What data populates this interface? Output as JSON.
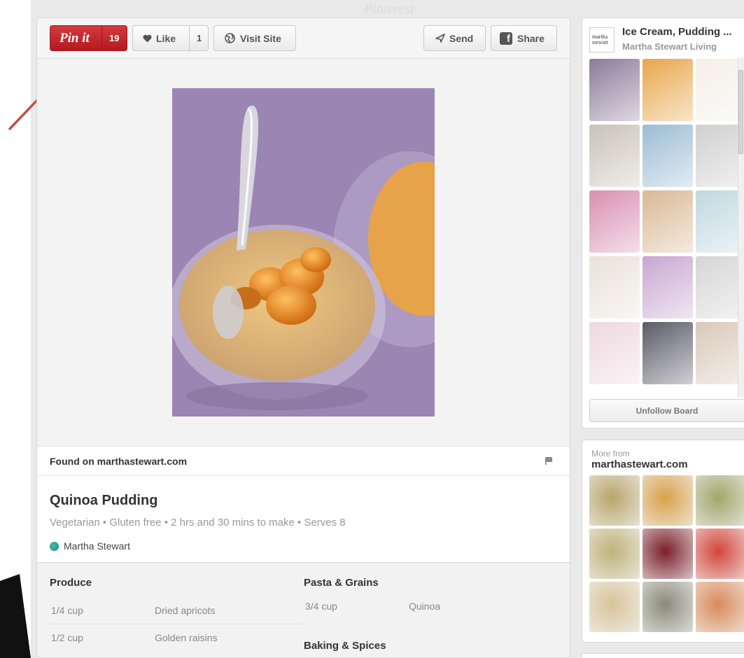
{
  "toolbar": {
    "pinit_label": "Pin it",
    "pinit_count": "19",
    "like_label": "Like",
    "like_count": "1",
    "visit_label": "Visit Site",
    "send_label": "Send",
    "share_label": "Share"
  },
  "found": {
    "text": "Found on marthastewart.com"
  },
  "recipe": {
    "title": "Quinoa Pudding",
    "meta": "Vegetarian • Gluten free • 2 hrs and 30 mins to make • Serves 8",
    "author": "Martha Stewart"
  },
  "ingredients": {
    "groups": [
      {
        "heading": "Produce",
        "rows": [
          {
            "qty": "1/4 cup",
            "item": "Dried apricots"
          },
          {
            "qty": "1/2 cup",
            "item": "Golden raisins"
          }
        ]
      },
      {
        "heading": "Pasta & Grains",
        "rows": [
          {
            "qty": "3/4 cup",
            "item": "Quinoa"
          }
        ]
      },
      {
        "heading": "Baking & Spices",
        "rows": []
      }
    ]
  },
  "board": {
    "logo_line1": "martha",
    "logo_line2": "stewart",
    "title": "Ice Cream, Pudding ...",
    "subtitle": "Martha Stewart Living",
    "unfollow_label": "Unfollow Board",
    "thumb_colors": [
      "#8c7a99",
      "#e8a64a",
      "#f4efe8",
      "#c9c2b6",
      "#9bbcd3",
      "#cfcfcf",
      "#d88fb0",
      "#d9b894",
      "#bfd8e0",
      "#e9e2d8",
      "#c8a7d1",
      "#d5d5d5",
      "#eed8e0",
      "#5a5a66",
      "#d9c8b8"
    ]
  },
  "more": {
    "label": "More from",
    "site": "marthastewart.com",
    "thumb_colors": [
      "#b9a56a",
      "#d9a24a",
      "#9fa76a",
      "#bfb27a",
      "#7a1f2a",
      "#d2453a",
      "#d8c49a",
      "#8a8a7a",
      "#d98a5a"
    ]
  }
}
